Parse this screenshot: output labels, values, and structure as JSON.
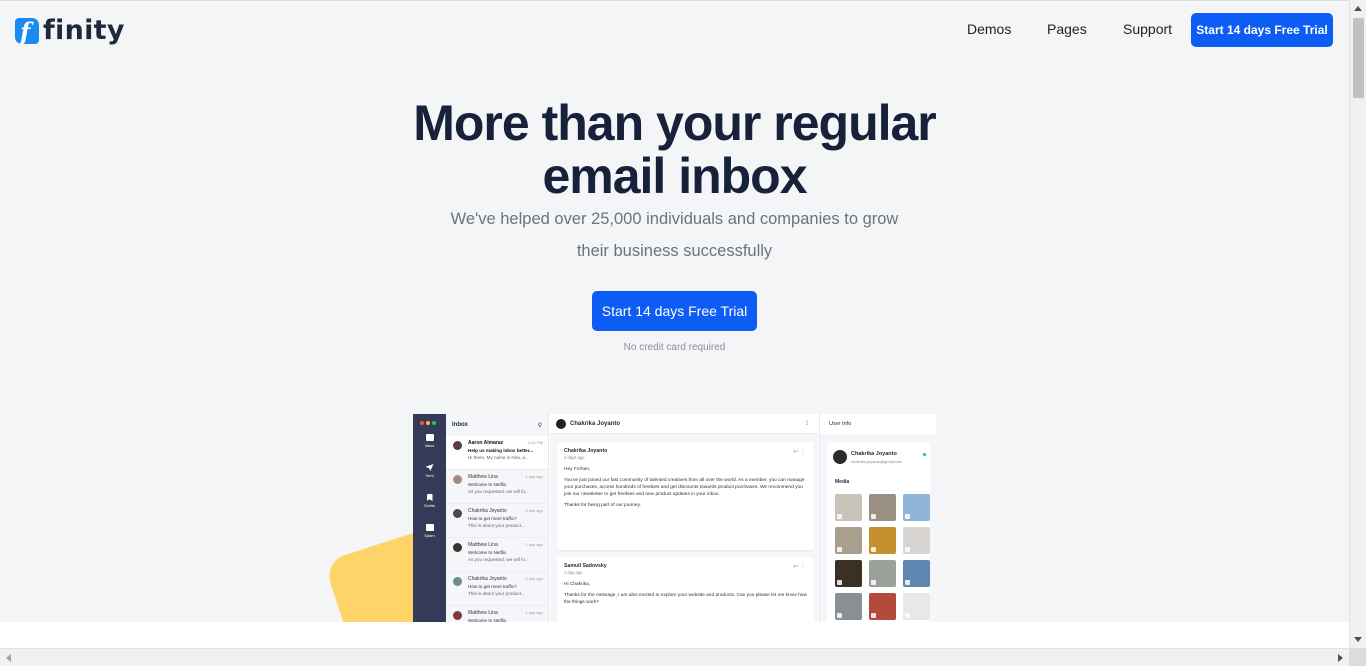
{
  "brand": {
    "logo_glyph": "f",
    "name": "finity",
    "accent": "#0d5cf4",
    "logo_color": "#1a8cf0"
  },
  "nav": {
    "items": [
      "Demos",
      "Pages",
      "Support"
    ],
    "cta": "Start 14 days Free Trial"
  },
  "hero": {
    "title_line1": "More than your regular",
    "title_line2": "email inbox",
    "subtitle_line1": "We've helped over 25,000 individuals and companies to grow",
    "subtitle_line2": "their business successfully",
    "cta": "Start 14 days Free Trial",
    "note": "No credit card required"
  },
  "mockup": {
    "sidebar": [
      "Inbox",
      "Sent",
      "Drafts",
      "Spam"
    ],
    "list_title": "Inbox",
    "list": [
      {
        "name": "Aaron Almaraz",
        "time": "2:42 PM",
        "subject": "Help us making inbox better...",
        "preview": "Hi there, My name is Nira, a...",
        "avatar": "#5a3b46"
      },
      {
        "name": "Matthew Lina",
        "time": "1 day ago",
        "subject": "Welcome to Netflix",
        "preview": "As you requested, we will fo...",
        "avatar": "#a58a7e"
      },
      {
        "name": "Chakrika Joyanto",
        "time": "2 day ago",
        "subject": "How to get more traffic?",
        "preview": "This is about your product...",
        "avatar": "#4a4a4a"
      },
      {
        "name": "Matthew Lina",
        "time": "1 day ago",
        "subject": "Welcome to Netflix",
        "preview": "As you requested, we will fo...",
        "avatar": "#3b3233"
      },
      {
        "name": "Chakrika Joyanto",
        "time": "2 day ago",
        "subject": "How to get more traffic?",
        "preview": "This is about your product...",
        "avatar": "#6f8a92"
      },
      {
        "name": "Matthew Lina",
        "time": "1 day ago",
        "subject": "Welcome to Netflix",
        "preview": "As you requested, we will fo...",
        "avatar": "#7a3c3c"
      }
    ],
    "conversation_title": "Chakrika Joyanto",
    "messages": [
      {
        "from": "Chakrika Joyanto",
        "date": "2 days ago",
        "greeting": "Hey Forhan,",
        "body": "You've just joined our fast community of talented creatives from all over the world. As a member, you can manage your purchases, access hundreds of freebies and get discounts towards product purchases. We recommend you join our newsletter to get freebies and new product updates in your inbox.",
        "closing": "Thanks for being part of our journey."
      },
      {
        "from": "Samuil Sadovsky",
        "date": "1 day ago",
        "greeting": "Hi Chakrika,",
        "body": "Thanks for the message, I am also excited to explore your website and products. Can you please let me know how the things work?",
        "closing": ""
      }
    ],
    "info": {
      "title": "User Info",
      "name": "Chakrika Joyanto",
      "email": "chakrika.joyanto@gmail.com",
      "media_label": "Media",
      "media_colors": [
        "#c9c2b8",
        "#9a8f83",
        "#8fb5d8",
        "#a8a08c",
        "#c7902e",
        "#d8d4d2",
        "#3a3024",
        "#9aa29b",
        "#5e86b0",
        "#8a8f94",
        "#b34a3a",
        "#e8e8e8"
      ]
    }
  },
  "colors": {
    "blob": "#fdd468"
  }
}
